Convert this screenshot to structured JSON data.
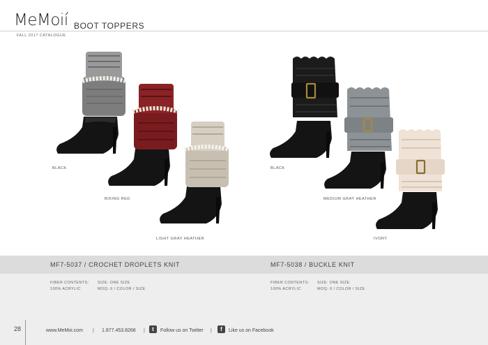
{
  "header": {
    "brand": "MeMoi",
    "brand_accent": "í",
    "section": "BOOT TOPPERS",
    "catalogue": "FALL 2017 CATALOGUE"
  },
  "products": [
    {
      "sku_title": "MF7-5037  /  CROCHET DROPLETS KNIT",
      "fiber_label": "FIBER CONTENTS:",
      "fiber_value": "100% ACRYLIC",
      "size": "SIZE: ONE SIZE",
      "moq": "MOQ: 6 / COLOR / SIZE",
      "colors": [
        "BLACK",
        "BIKING RED",
        "LIGHT GRAY HEATHER"
      ]
    },
    {
      "sku_title": "MF7-5038  /  BUCKLE KNIT",
      "fiber_label": "FIBER CONTENTS:",
      "fiber_value": "100% ACRYLIC",
      "size": "SIZE: ONE SIZE",
      "moq": "MOQ: 6 / COLOR / SIZE",
      "colors": [
        "BLACK",
        "MEDIUM GRAY HEATHER",
        "IVORY"
      ]
    }
  ],
  "footer": {
    "page": "28",
    "website": "www.MeMoi.com",
    "phone": "1.877.453.8268",
    "twitter": "Follow us on Twitter",
    "facebook": "Like us on Facebook",
    "separator": "|"
  },
  "colors": {
    "boot_leather": "#141414",
    "topper_gray": "#8a8a8a",
    "topper_red": "#8a1f22",
    "topper_light_gray": "#cfc9bd",
    "topper_black": "#1b1b1b",
    "topper_medium_gray": "#8d9296",
    "topper_ivory": "#efe2d6",
    "buckle": "#a88a3a"
  }
}
